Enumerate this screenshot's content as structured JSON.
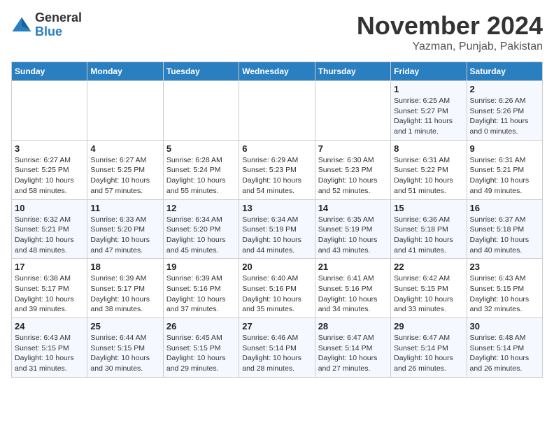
{
  "header": {
    "logo_general": "General",
    "logo_blue": "Blue",
    "month_title": "November 2024",
    "location": "Yazman, Punjab, Pakistan"
  },
  "days_of_week": [
    "Sunday",
    "Monday",
    "Tuesday",
    "Wednesday",
    "Thursday",
    "Friday",
    "Saturday"
  ],
  "weeks": [
    [
      {
        "day": "",
        "info": ""
      },
      {
        "day": "",
        "info": ""
      },
      {
        "day": "",
        "info": ""
      },
      {
        "day": "",
        "info": ""
      },
      {
        "day": "",
        "info": ""
      },
      {
        "day": "1",
        "info": "Sunrise: 6:25 AM\nSunset: 5:27 PM\nDaylight: 11 hours\nand 1 minute."
      },
      {
        "day": "2",
        "info": "Sunrise: 6:26 AM\nSunset: 5:26 PM\nDaylight: 11 hours\nand 0 minutes."
      }
    ],
    [
      {
        "day": "3",
        "info": "Sunrise: 6:27 AM\nSunset: 5:25 PM\nDaylight: 10 hours\nand 58 minutes."
      },
      {
        "day": "4",
        "info": "Sunrise: 6:27 AM\nSunset: 5:25 PM\nDaylight: 10 hours\nand 57 minutes."
      },
      {
        "day": "5",
        "info": "Sunrise: 6:28 AM\nSunset: 5:24 PM\nDaylight: 10 hours\nand 55 minutes."
      },
      {
        "day": "6",
        "info": "Sunrise: 6:29 AM\nSunset: 5:23 PM\nDaylight: 10 hours\nand 54 minutes."
      },
      {
        "day": "7",
        "info": "Sunrise: 6:30 AM\nSunset: 5:23 PM\nDaylight: 10 hours\nand 52 minutes."
      },
      {
        "day": "8",
        "info": "Sunrise: 6:31 AM\nSunset: 5:22 PM\nDaylight: 10 hours\nand 51 minutes."
      },
      {
        "day": "9",
        "info": "Sunrise: 6:31 AM\nSunset: 5:21 PM\nDaylight: 10 hours\nand 49 minutes."
      }
    ],
    [
      {
        "day": "10",
        "info": "Sunrise: 6:32 AM\nSunset: 5:21 PM\nDaylight: 10 hours\nand 48 minutes."
      },
      {
        "day": "11",
        "info": "Sunrise: 6:33 AM\nSunset: 5:20 PM\nDaylight: 10 hours\nand 47 minutes."
      },
      {
        "day": "12",
        "info": "Sunrise: 6:34 AM\nSunset: 5:20 PM\nDaylight: 10 hours\nand 45 minutes."
      },
      {
        "day": "13",
        "info": "Sunrise: 6:34 AM\nSunset: 5:19 PM\nDaylight: 10 hours\nand 44 minutes."
      },
      {
        "day": "14",
        "info": "Sunrise: 6:35 AM\nSunset: 5:19 PM\nDaylight: 10 hours\nand 43 minutes."
      },
      {
        "day": "15",
        "info": "Sunrise: 6:36 AM\nSunset: 5:18 PM\nDaylight: 10 hours\nand 41 minutes."
      },
      {
        "day": "16",
        "info": "Sunrise: 6:37 AM\nSunset: 5:18 PM\nDaylight: 10 hours\nand 40 minutes."
      }
    ],
    [
      {
        "day": "17",
        "info": "Sunrise: 6:38 AM\nSunset: 5:17 PM\nDaylight: 10 hours\nand 39 minutes."
      },
      {
        "day": "18",
        "info": "Sunrise: 6:39 AM\nSunset: 5:17 PM\nDaylight: 10 hours\nand 38 minutes."
      },
      {
        "day": "19",
        "info": "Sunrise: 6:39 AM\nSunset: 5:16 PM\nDaylight: 10 hours\nand 37 minutes."
      },
      {
        "day": "20",
        "info": "Sunrise: 6:40 AM\nSunset: 5:16 PM\nDaylight: 10 hours\nand 35 minutes."
      },
      {
        "day": "21",
        "info": "Sunrise: 6:41 AM\nSunset: 5:16 PM\nDaylight: 10 hours\nand 34 minutes."
      },
      {
        "day": "22",
        "info": "Sunrise: 6:42 AM\nSunset: 5:15 PM\nDaylight: 10 hours\nand 33 minutes."
      },
      {
        "day": "23",
        "info": "Sunrise: 6:43 AM\nSunset: 5:15 PM\nDaylight: 10 hours\nand 32 minutes."
      }
    ],
    [
      {
        "day": "24",
        "info": "Sunrise: 6:43 AM\nSunset: 5:15 PM\nDaylight: 10 hours\nand 31 minutes."
      },
      {
        "day": "25",
        "info": "Sunrise: 6:44 AM\nSunset: 5:15 PM\nDaylight: 10 hours\nand 30 minutes."
      },
      {
        "day": "26",
        "info": "Sunrise: 6:45 AM\nSunset: 5:15 PM\nDaylight: 10 hours\nand 29 minutes."
      },
      {
        "day": "27",
        "info": "Sunrise: 6:46 AM\nSunset: 5:14 PM\nDaylight: 10 hours\nand 28 minutes."
      },
      {
        "day": "28",
        "info": "Sunrise: 6:47 AM\nSunset: 5:14 PM\nDaylight: 10 hours\nand 27 minutes."
      },
      {
        "day": "29",
        "info": "Sunrise: 6:47 AM\nSunset: 5:14 PM\nDaylight: 10 hours\nand 26 minutes."
      },
      {
        "day": "30",
        "info": "Sunrise: 6:48 AM\nSunset: 5:14 PM\nDaylight: 10 hours\nand 26 minutes."
      }
    ]
  ]
}
